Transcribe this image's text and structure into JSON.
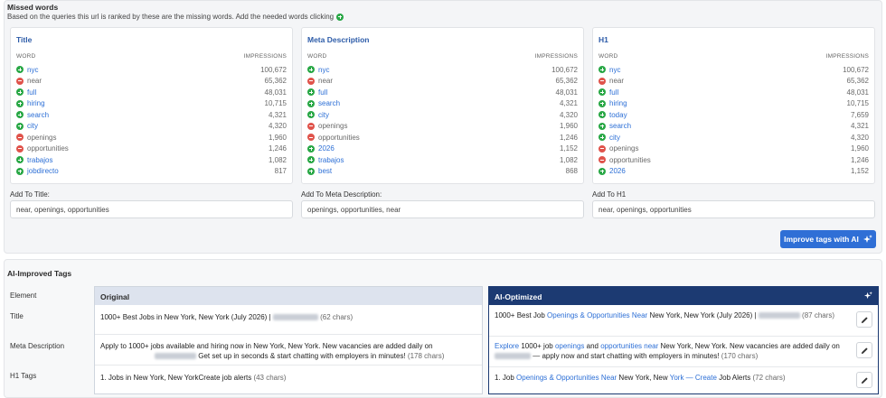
{
  "missed": {
    "title": "Missed words",
    "subtitle": "Based on the queries this url is ranked by these are the missing words. Add the needed words clicking"
  },
  "cards": [
    {
      "title": "Title",
      "col_word": "WORD",
      "col_impressions": "IMPRESSIONS",
      "rows": [
        {
          "status": "add",
          "word": "nyc",
          "impressions": "100,672"
        },
        {
          "status": "remove",
          "word": "near",
          "impressions": "65,362"
        },
        {
          "status": "add",
          "word": "full",
          "impressions": "48,031"
        },
        {
          "status": "add",
          "word": "hiring",
          "impressions": "10,715"
        },
        {
          "status": "add",
          "word": "search",
          "impressions": "4,321"
        },
        {
          "status": "add",
          "word": "city",
          "impressions": "4,320"
        },
        {
          "status": "remove",
          "word": "openings",
          "impressions": "1,960"
        },
        {
          "status": "remove",
          "word": "opportunities",
          "impressions": "1,246"
        },
        {
          "status": "add",
          "word": "trabajos",
          "impressions": "1,082"
        },
        {
          "status": "add",
          "word": "jobdirecto",
          "impressions": "817"
        }
      ],
      "add_label": "Add To Title:",
      "add_value": "near, openings, opportunities"
    },
    {
      "title": "Meta Description",
      "col_word": "WORD",
      "col_impressions": "IMPRESSIONS",
      "rows": [
        {
          "status": "add",
          "word": "nyc",
          "impressions": "100,672"
        },
        {
          "status": "remove",
          "word": "near",
          "impressions": "65,362"
        },
        {
          "status": "add",
          "word": "full",
          "impressions": "48,031"
        },
        {
          "status": "add",
          "word": "search",
          "impressions": "4,321"
        },
        {
          "status": "add",
          "word": "city",
          "impressions": "4,320"
        },
        {
          "status": "remove",
          "word": "openings",
          "impressions": "1,960"
        },
        {
          "status": "remove",
          "word": "opportunities",
          "impressions": "1,246"
        },
        {
          "status": "add",
          "word": "2026",
          "impressions": "1,152"
        },
        {
          "status": "add",
          "word": "trabajos",
          "impressions": "1,082"
        },
        {
          "status": "add",
          "word": "best",
          "impressions": "868"
        }
      ],
      "add_label": "Add To Meta Description:",
      "add_value": "openings, opportunities, near"
    },
    {
      "title": "H1",
      "col_word": "WORD",
      "col_impressions": "IMPRESSIONS",
      "rows": [
        {
          "status": "add",
          "word": "nyc",
          "impressions": "100,672"
        },
        {
          "status": "remove",
          "word": "near",
          "impressions": "65,362"
        },
        {
          "status": "add",
          "word": "full",
          "impressions": "48,031"
        },
        {
          "status": "add",
          "word": "hiring",
          "impressions": "10,715"
        },
        {
          "status": "add",
          "word": "today",
          "impressions": "7,659"
        },
        {
          "status": "add",
          "word": "search",
          "impressions": "4,321"
        },
        {
          "status": "add",
          "word": "city",
          "impressions": "4,320"
        },
        {
          "status": "remove",
          "word": "openings",
          "impressions": "1,960"
        },
        {
          "status": "remove",
          "word": "opportunities",
          "impressions": "1,246"
        },
        {
          "status": "add",
          "word": "2026",
          "impressions": "1,152"
        }
      ],
      "add_label": "Add To H1",
      "add_value": "near, openings, opportunities"
    }
  ],
  "improve_button": "Improve tags with AI",
  "ai": {
    "title": "AI-Improved Tags",
    "element_label": "Element",
    "original_header": "Original",
    "optimized_header": "AI-Optimized",
    "rows": {
      "title_label": "Title",
      "meta_label": "Meta Description",
      "h1_label": "H1 Tags"
    },
    "original": {
      "title_text": "1000+ Best Jobs in New York, New York (July 2026) |",
      "title_chars": "(62 chars)",
      "meta_text_1": "Apply to 1000+ jobs available and hiring now in New York, New York. New vacancies are added daily on",
      "meta_text_2": "Get set up in seconds & start chatting with employers in minutes!",
      "meta_chars": "(178 chars)",
      "h1_text": "1. Jobs in New York, New YorkCreate job alerts",
      "h1_chars": "(43 chars)"
    },
    "optimized": {
      "title_a": "1000+ Best Job ",
      "title_b": "Openings & Opportunities Near",
      "title_c": " New York, New York (July 2026) |",
      "title_chars": "(87 chars)",
      "meta_a": "Explore",
      "meta_b": " 1000+ job ",
      "meta_c": "openings",
      "meta_d": " and ",
      "meta_e": "opportunities near",
      "meta_f": " New York, New York. New vacancies are added",
      "meta_g": "daily on",
      "meta_h": " — apply now and start chatting with employers in minutes!",
      "meta_chars": "(170 chars)",
      "h1_a": "1. Job ",
      "h1_b": "Openings & Opportunities Near",
      "h1_c": " New York, New ",
      "h1_d": "York — Create",
      "h1_e": " Job Alerts",
      "h1_chars": "(72 chars)"
    }
  },
  "colors": {
    "accent": "#2f6fd6",
    "add": "#28a745",
    "remove": "#e0534b",
    "optimized_header": "#1c3a72"
  }
}
